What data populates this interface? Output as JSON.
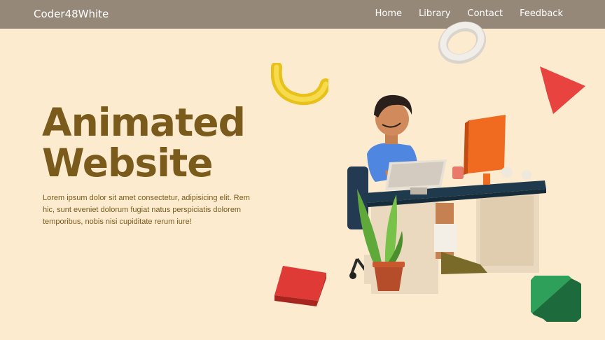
{
  "navbar": {
    "brand": "Coder48White",
    "links": [
      "Home",
      "Library",
      "Contact",
      "Feedback"
    ]
  },
  "hero": {
    "title_line1": "Animated",
    "title_line2": "Website",
    "text": "Lorem ipsum dolor sit amet consectetur, adipisicing elit. Rem hic, sunt eveniet dolorum fugiat natus perspiciatis dolorem temporibus, nobis nisi cupiditate rerum iure!"
  },
  "colors": {
    "background": "#fdebd0",
    "navbar": "#958879",
    "heading": "#7a5b1c"
  }
}
